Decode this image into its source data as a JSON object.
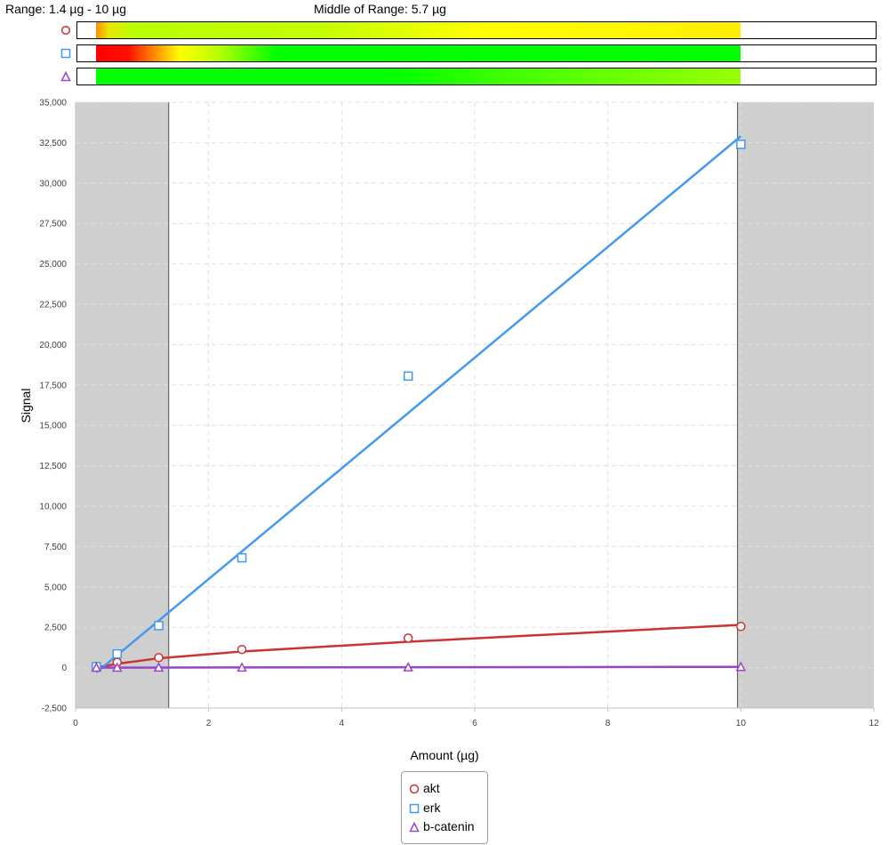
{
  "header": {
    "range_text": "Range: 1.4 µg - 10 µg",
    "middle_text": "Middle of Range: 5.7 µg"
  },
  "colors": {
    "akt": "#cc3333",
    "erk": "#4499ee",
    "b-catenin": "#9944cc",
    "shade": "#cfcfcf",
    "grid": "#e0e0e0"
  },
  "range_bars": [
    {
      "series": "akt",
      "icon": "circle-icon",
      "fill_x": [
        0.3125,
        10
      ],
      "gradient": [
        "#ff8c00 0%",
        "#e8e800 2%",
        "#b8ff00 6%",
        "#c4ff00 35%",
        "#ffff00 60%",
        "#ffef00 100%"
      ]
    },
    {
      "series": "erk",
      "icon": "square-icon",
      "fill_x": [
        0.3125,
        10
      ],
      "gradient": [
        "#ff0000 0%",
        "#ff1000 5%",
        "#ffff00 13%",
        "#b8ff00 19%",
        "#00ff00 28%",
        "#00ff00 100%"
      ]
    },
    {
      "series": "b-catenin",
      "icon": "triangle-icon",
      "fill_x": [
        0.3125,
        10
      ],
      "gradient": [
        "#00ff00 0%",
        "#00ff00 45%",
        "#44ff00 65%",
        "#99ff00 100%"
      ]
    }
  ],
  "chart_data": {
    "type": "scatter",
    "xlabel": "Amount (µg)",
    "ylabel": "Signal",
    "xlim": [
      0,
      12
    ],
    "ylim": [
      -2500,
      35000
    ],
    "x_ticks": [
      0,
      2,
      4,
      6,
      8,
      10,
      12
    ],
    "y_ticks": [
      -2500,
      0,
      2500,
      5000,
      7500,
      10000,
      12500,
      15000,
      17500,
      20000,
      22500,
      25000,
      27500,
      30000,
      32500,
      35000
    ],
    "grid": true,
    "shaded_out_of_range": [
      [
        0,
        1.4
      ],
      [
        9.95,
        12
      ]
    ],
    "range_boundaries": [
      1.4,
      9.95
    ],
    "legend_placement": "bottom-center",
    "series": [
      {
        "name": "akt",
        "marker": "circle",
        "x": [
          0.3125,
          0.625,
          1.25,
          2.5,
          5,
          10
        ],
        "y": [
          80,
          330,
          620,
          1120,
          1830,
          2550
        ],
        "fit": {
          "x": [
            0.3125,
            0.625,
            1.25,
            2.5,
            5,
            10
          ],
          "y": [
            0,
            240,
            580,
            1000,
            1600,
            2650
          ]
        }
      },
      {
        "name": "erk",
        "marker": "square",
        "x": [
          0.3125,
          0.625,
          1.25,
          2.5,
          5,
          10
        ],
        "y": [
          60,
          850,
          2600,
          6800,
          18050,
          32400
        ],
        "fit": {
          "x": [
            0.3125,
            10
          ],
          "y": [
            -300,
            32900
          ]
        }
      },
      {
        "name": "b-catenin",
        "marker": "triangle",
        "x": [
          0.3125,
          0.625,
          1.25,
          2.5,
          5,
          10
        ],
        "y": [
          5,
          8,
          12,
          15,
          25,
          45
        ],
        "fit": {
          "x": [
            0.3125,
            10
          ],
          "y": [
            0,
            50
          ]
        }
      }
    ]
  },
  "legend": {
    "items": [
      {
        "label": "akt",
        "icon": "circle-icon"
      },
      {
        "label": "erk",
        "icon": "square-icon"
      },
      {
        "label": "b-catenin",
        "icon": "triangle-icon"
      }
    ]
  }
}
